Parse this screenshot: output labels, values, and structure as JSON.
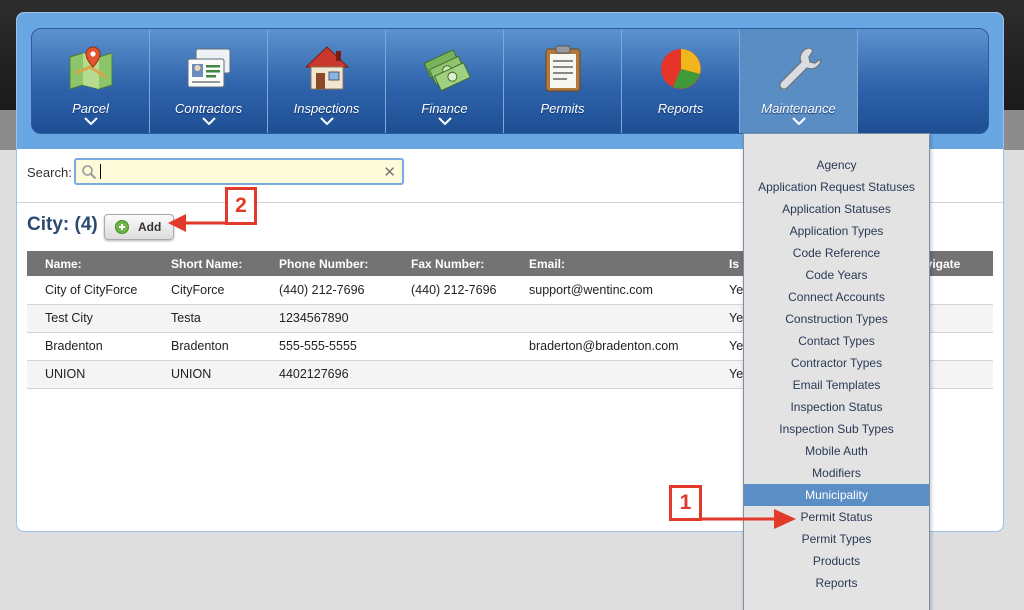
{
  "nav": {
    "items": [
      {
        "label": "Parcel",
        "icon": "map-pin-icon"
      },
      {
        "label": "Contractors",
        "icon": "id-card-icon"
      },
      {
        "label": "Inspections",
        "icon": "house-icon"
      },
      {
        "label": "Finance",
        "icon": "money-icon"
      },
      {
        "label": "Permits",
        "icon": "clipboard-icon"
      },
      {
        "label": "Reports",
        "icon": "pie-chart-icon"
      },
      {
        "label": "Maintenance",
        "icon": "wrench-icon"
      }
    ]
  },
  "search": {
    "label": "Search:",
    "value": ""
  },
  "city": {
    "title": "City: (4)",
    "add_label": "Add"
  },
  "table": {
    "columns": [
      "Name:",
      "Short Name:",
      "Phone Number:",
      "Fax Number:",
      "Email:",
      "Is",
      "avigate"
    ],
    "rows": [
      {
        "name": "City of CityForce",
        "short": "CityForce",
        "phone": "(440) 212-7696",
        "fax": "(440) 212-7696",
        "email": "support@wentinc.com",
        "is": "Ye"
      },
      {
        "name": "Test City",
        "short": "Testa",
        "phone": "1234567890",
        "fax": "",
        "email": "",
        "is": "Ye"
      },
      {
        "name": "Bradenton",
        "short": "Bradenton",
        "phone": "555-555-5555",
        "fax": "",
        "email": "braderton@bradenton.com",
        "is": "Ye"
      },
      {
        "name": "UNION",
        "short": "UNION",
        "phone": "4402127696",
        "fax": "",
        "email": "",
        "is": "Ye"
      }
    ]
  },
  "dropdown": {
    "items": [
      "Agency",
      "Application Request Statuses",
      "Application Statuses",
      "Application Types",
      "Code Reference",
      "Code Years",
      "Connect Accounts",
      "Construction Types",
      "Contact Types",
      "Contractor Types",
      "Email Templates",
      "Inspection Status",
      "Inspection Sub Types",
      "Mobile Auth",
      "Modifiers",
      "Municipality",
      "Permit Status",
      "Permit Types",
      "Products",
      "Reports"
    ],
    "selected": "Municipality"
  },
  "callouts": {
    "one": "1",
    "two": "2"
  },
  "colors": {
    "accent": "#e23a2a",
    "nav_blue": "#2f63ab",
    "selected": "#5c8ec6"
  }
}
